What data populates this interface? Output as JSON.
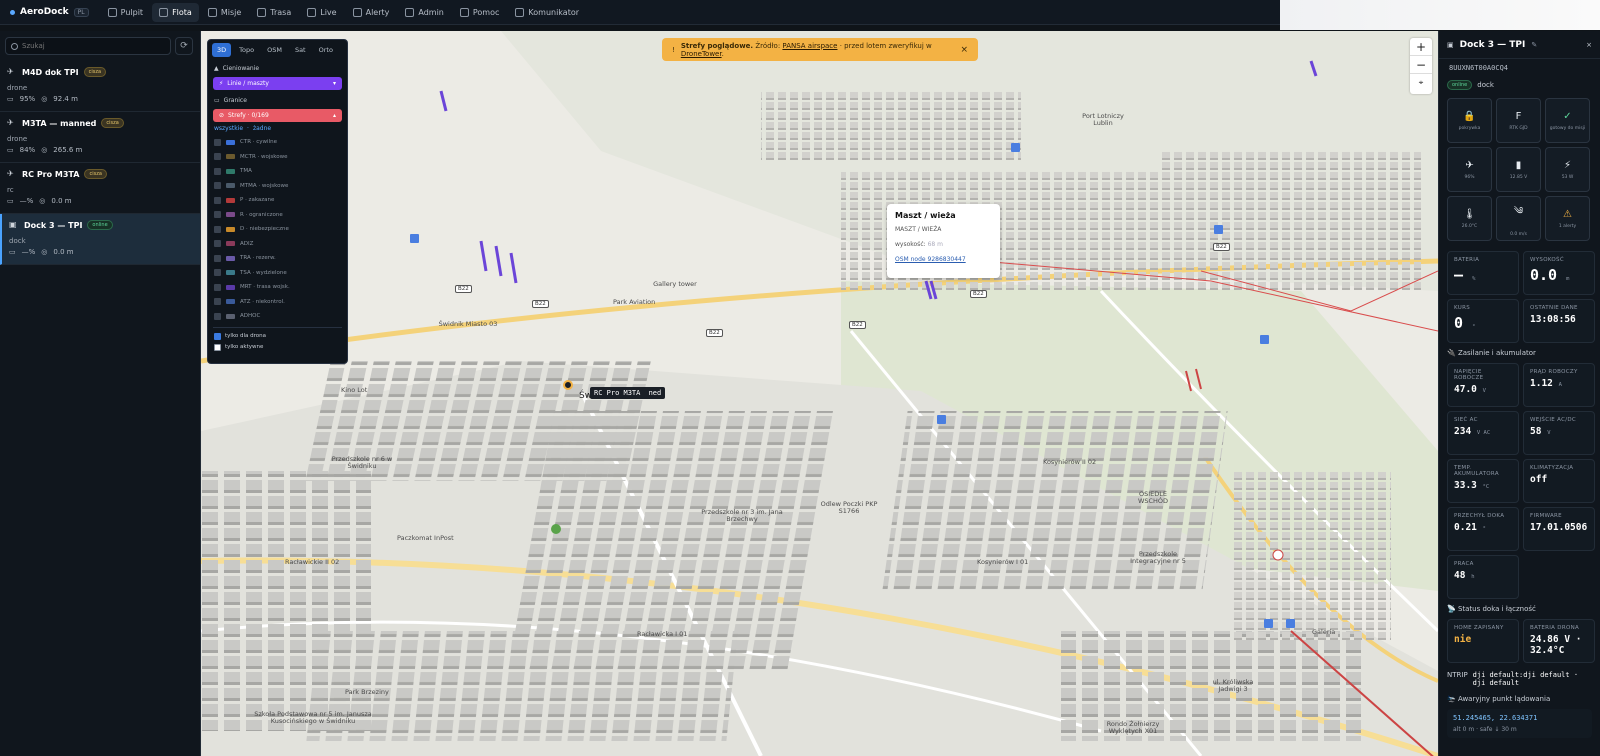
{
  "app": {
    "name": "AeroDock",
    "lang": "PL"
  },
  "nav": [
    {
      "label": "Pulpit",
      "icon": "dashboard-icon"
    },
    {
      "label": "Flota",
      "icon": "drone-icon",
      "active": true
    },
    {
      "label": "Misje",
      "icon": "list-icon"
    },
    {
      "label": "Trasa",
      "icon": "map-icon"
    },
    {
      "label": "Live",
      "icon": "video-icon"
    },
    {
      "label": "Alerty",
      "icon": "bell-icon"
    },
    {
      "label": "Admin",
      "icon": "gear-icon"
    },
    {
      "label": "Pomoc",
      "icon": "help-icon"
    },
    {
      "label": "Komunikator",
      "icon": "chat-icon"
    }
  ],
  "sidebar": {
    "search_placeholder": "Szukaj",
    "assets": [
      {
        "name": "M4D dok TPI",
        "badge": "cisza",
        "type": "drone",
        "battery": "95%",
        "altitude": "92.4 m"
      },
      {
        "name": "M3TA — manned",
        "badge": "cisza",
        "type": "drone",
        "battery": "84%",
        "altitude": "265.6 m"
      },
      {
        "name": "RC Pro M3TA",
        "badge": "cisza",
        "type": "rc",
        "battery": "—%",
        "altitude": "0.0 m"
      },
      {
        "name": "Dock 3 — TPI",
        "badge": "online",
        "type": "dock",
        "battery": "—%",
        "altitude": "0.0 m"
      }
    ]
  },
  "layers": {
    "tabs": [
      "3D",
      "Topo",
      "OSM",
      "Sat",
      "Orto"
    ],
    "shading": "Cieniowanie",
    "lines": "Linie / maszty",
    "borders": "Granice",
    "zones": "Strefy · 0/169",
    "all": "wszystkie",
    "none": "żadne",
    "zone_list": [
      {
        "label": "CTR · cywilne",
        "color": "#3a6fd8"
      },
      {
        "label": "MCTR · wojskowe",
        "color": "#6b5a2e"
      },
      {
        "label": "TMA",
        "color": "#2f7a6a"
      },
      {
        "label": "MTMA · wojskowe",
        "color": "#4a5a6a"
      },
      {
        "label": "P · zakazane",
        "color": "#b33a3a"
      },
      {
        "label": "R · ograniczone",
        "color": "#7a4a8a"
      },
      {
        "label": "D · niebezpieczne",
        "color": "#c88a2a"
      },
      {
        "label": "ADIZ",
        "color": "#8a3a5a"
      },
      {
        "label": "TRA · rezerw.",
        "color": "#6a5aa8"
      },
      {
        "label": "TSA · wydzielone",
        "color": "#3a7a8a"
      },
      {
        "label": "MRT · trasa wojsk.",
        "color": "#5a3aa8"
      },
      {
        "label": "ATZ · niekontrol.",
        "color": "#3a5a9a"
      },
      {
        "label": "ADHOC",
        "color": "#5a6070"
      }
    ],
    "only_drone": "tylko dla drona",
    "only_active": "tylko aktywne"
  },
  "banner": {
    "strong": "Strefy poglądowe.",
    "text1": " Źródło: ",
    "link1": "PANSA airspace",
    "text2": " · przed lotem zweryfikuj w ",
    "link2": "DroneTower",
    "text3": "."
  },
  "popup": {
    "title": "Maszt / wieża",
    "subtitle": "MASZT / WIEŻA",
    "height_label": "wysokość:",
    "height_value": "68 m",
    "link": "OSM node 9286830447"
  },
  "map": {
    "drone_tag": "RC Pro M3TA",
    "drone_tag2": "ned",
    "labels": [
      {
        "t": "Świdnik",
        "big": true
      },
      {
        "t": "Port Lotniczy Lublin"
      },
      {
        "t": "Świdnik Miasto 03"
      },
      {
        "t": "Kino Lot"
      },
      {
        "t": "Gallery tower"
      },
      {
        "t": "Park Aviation"
      },
      {
        "t": "Przedszkole nr 6 w Świdniku"
      },
      {
        "t": "Paczkomat InPost"
      },
      {
        "t": "Racławickie II 02"
      },
      {
        "t": "Racławicka I 01"
      },
      {
        "t": "Park Brzeziny"
      },
      {
        "t": "Kosynierów II 02"
      },
      {
        "t": "Kosynierów I 01"
      },
      {
        "t": "Przedszkole Integracyjne nr 5"
      },
      {
        "t": "OSIEDLE WSCHÓD"
      },
      {
        "t": "Szkoła Podstawowa nr 5 im. Janusza Kusocińskiego w Świdniku"
      },
      {
        "t": "Przedszkole nr 3 im. Jana Brzechwy"
      },
      {
        "t": "Odlew Poczki PKP S1766"
      },
      {
        "t": "Galeria"
      },
      {
        "t": "Rondo Żołnierzy Wyklętych X01"
      },
      {
        "t": "ul. Króliwska Jadwigi 3"
      }
    ],
    "roads": [
      "B22",
      "B22",
      "B22",
      "B22",
      "B22",
      "B22"
    ]
  },
  "right": {
    "title": "Dock 3 — TPI",
    "serial": "8UUXN6T00A0CQ4",
    "status": "online",
    "type": "dock",
    "tiles": [
      {
        "icon": "lock-icon",
        "glyph": "🔒",
        "label": "pokrywka"
      },
      {
        "icon": "rtk-icon",
        "glyph": "F",
        "label": "RTK GJD"
      },
      {
        "icon": "check-icon",
        "glyph": "✓",
        "label": "gotowy do misji"
      },
      {
        "icon": "drone-icon",
        "glyph": "✈",
        "label": "96%"
      },
      {
        "icon": "battery-icon",
        "glyph": "▮",
        "label": "12.85 V"
      },
      {
        "icon": "bolt-icon",
        "glyph": "⚡",
        "label": "53 W"
      },
      {
        "icon": "thermometer-icon",
        "glyph": "🌡",
        "label": "26.0°C"
      },
      {
        "icon": "wind-icon",
        "glyph": "༄",
        "label": "0.0 m/s"
      },
      {
        "icon": "warning-icon",
        "glyph": "⚠",
        "label": "1 alerty"
      }
    ],
    "main_kv": [
      {
        "label": "BATERIA",
        "value": "—",
        "unit": "%"
      },
      {
        "label": "WYSOKOŚĆ",
        "value": "0.0",
        "unit": "m"
      },
      {
        "label": "KURS",
        "value": "0",
        "unit": "°"
      },
      {
        "label": "OSTATNIE DANE",
        "value": "13:08:56",
        "unit": ""
      }
    ],
    "power_title": "Zasilanie i akumulator",
    "power_kv": [
      {
        "label": "NAPIĘCIE ROBOCZE",
        "value": "47.0",
        "unit": "V"
      },
      {
        "label": "PRĄD ROBOCZY",
        "value": "1.12",
        "unit": "A"
      },
      {
        "label": "SIEĆ AC",
        "value": "234",
        "unit": "V AC"
      },
      {
        "label": "WEJŚCIE AC/DC",
        "value": "58",
        "unit": "V"
      },
      {
        "label": "TEMP. AKUMULATORA",
        "value": "33.3",
        "unit": "°C"
      },
      {
        "label": "KLIMATYZACJA",
        "value": "off",
        "unit": ""
      },
      {
        "label": "PRZECHYŁ DOKA",
        "value": "0.21",
        "unit": "°"
      },
      {
        "label": "FIRMWARE",
        "value": "17.01.0506",
        "unit": ""
      },
      {
        "label": "PRACA",
        "value": "48",
        "unit": "h"
      }
    ],
    "status_title": "Status doka i łączność",
    "status_kv": [
      {
        "label": "HOME ZAPISANY",
        "value": "nie",
        "unit": ""
      },
      {
        "label": "BATERIA DRONA",
        "value": "24.86 V · 32.4°C",
        "unit": ""
      }
    ],
    "ntrip_label": "NTRIP",
    "ntrip_value": "dji default:dji default · dji default",
    "emergency_title": "Awaryjny punkt lądowania",
    "emergency_coords": "51.245465, 22.634371",
    "emergency_info": "alt 0 m · safe ↓ 30 m"
  }
}
